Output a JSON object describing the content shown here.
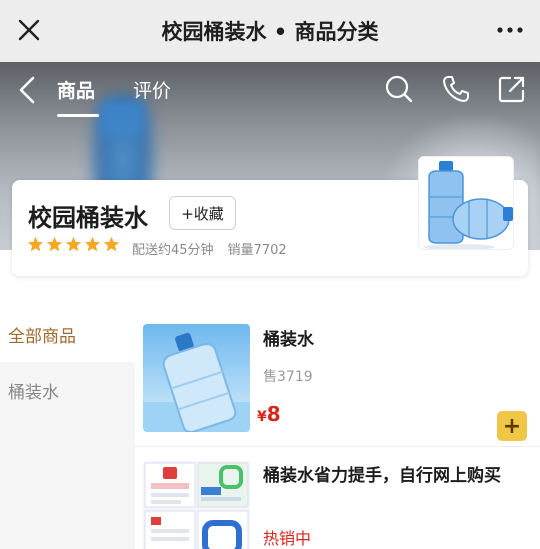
{
  "topbar": {
    "title": "校园桶装水 • 商品分类",
    "close_icon": "close-icon",
    "more_icon": "more-dots-icon"
  },
  "nav": {
    "tabs": [
      {
        "label": "商品",
        "active": true
      },
      {
        "label": "评价",
        "active": false
      }
    ],
    "icons": [
      "back-arrow-icon",
      "search-icon",
      "phone-icon",
      "share-icon"
    ]
  },
  "store": {
    "name": "校园桶装水",
    "favorite_label": "+收藏",
    "rating_stars": 5,
    "delivery_time": "配送约45分钟",
    "sales_volume": "销量7702",
    "colors": {
      "star": "#f5a623"
    }
  },
  "categories": [
    {
      "label": "全部商品",
      "active": true
    },
    {
      "label": "桶装水",
      "active": false
    }
  ],
  "products": [
    {
      "name": "桶装水",
      "sales": "售3719",
      "currency": "¥",
      "price": "8",
      "add_label": "+"
    },
    {
      "name": "桶装水省力提手，自行网上购买",
      "status": "热销中"
    }
  ],
  "colors": {
    "accent_price": "#d8261d",
    "active_category": "#a06a2e",
    "add_button": "#f0c646"
  }
}
